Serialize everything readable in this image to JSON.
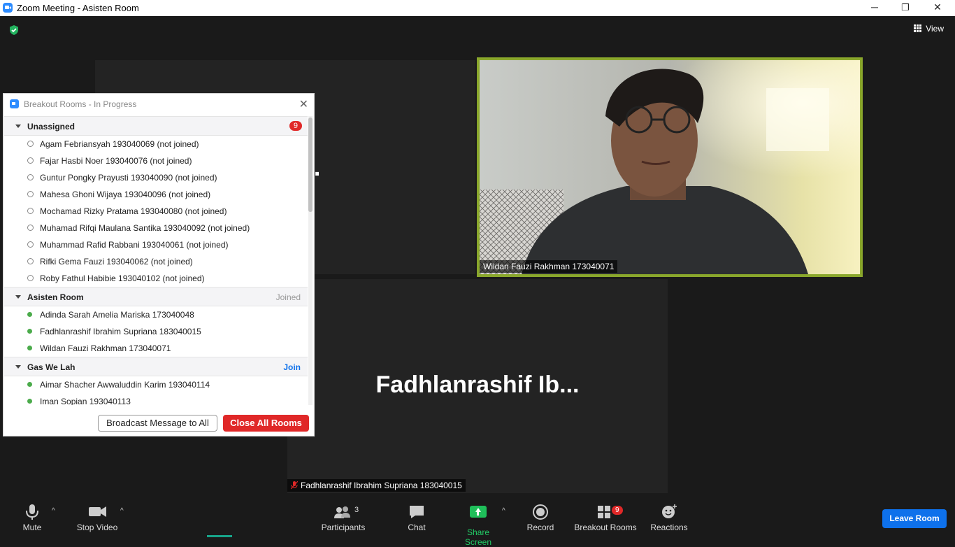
{
  "window": {
    "title": "Zoom Meeting - Asisten Room",
    "minimize": "─",
    "restore": "❐",
    "close": "✕"
  },
  "top": {
    "view_label": "View"
  },
  "tiles": {
    "partial_name": "ah A...",
    "video_name": "Wildan Fauzi Rakhman 173040071",
    "big_name_b": "Fadhlanrashif  Ib...",
    "name_b": "Fadhlanrashif Ibrahim Supriana 183040015"
  },
  "breakout": {
    "title": "Breakout Rooms - In Progress",
    "close": "✕",
    "unassigned": {
      "label": "Unassigned",
      "count": "9",
      "members": [
        "Agam Febriansyah 193040069 (not joined)",
        "Fajar Hasbi Noer 193040076 (not joined)",
        "Guntur Pongky Prayusti 193040090 (not joined)",
        "Mahesa Ghoni Wijaya 193040096 (not joined)",
        "Mochamad Rizky Pratama 193040080 (not joined)",
        "Muhamad Rifqi Maulana Santika 193040092 (not joined)",
        "Muhammad Rafid Rabbani 193040061 (not joined)",
        "Rifki Gema Fauzi 193040062 (not joined)",
        "Roby Fathul Habibie 193040102 (not joined)"
      ]
    },
    "asisten": {
      "label": "Asisten Room",
      "status": "Joined",
      "members": [
        "Adinda Sarah Amelia Mariska 173040048",
        "Fadhlanrashif Ibrahim Supriana 183040015",
        "Wildan Fauzi Rakhman 173040071"
      ]
    },
    "gas": {
      "label": "Gas We Lah",
      "action": "Join",
      "members": [
        "Aimar Shacher Awwaluddin Karim 193040114",
        "Iman Sopian 193040113"
      ]
    },
    "broadcast_label": "Broadcast Message to All",
    "close_all_label": "Close All Rooms"
  },
  "toolbar": {
    "mute": "Mute",
    "stop_video": "Stop Video",
    "participants": "Participants",
    "participants_count": "3",
    "chat": "Chat",
    "share_screen": "Share Screen",
    "record": "Record",
    "breakout_rooms": "Breakout Rooms",
    "breakout_count": "9",
    "reactions": "Reactions",
    "leave": "Leave Room",
    "caret": "^"
  },
  "colors": {
    "accent": "#0e71eb",
    "danger": "#e02828",
    "share": "#1fbf5a",
    "active_speaker": "#8aa72c"
  }
}
